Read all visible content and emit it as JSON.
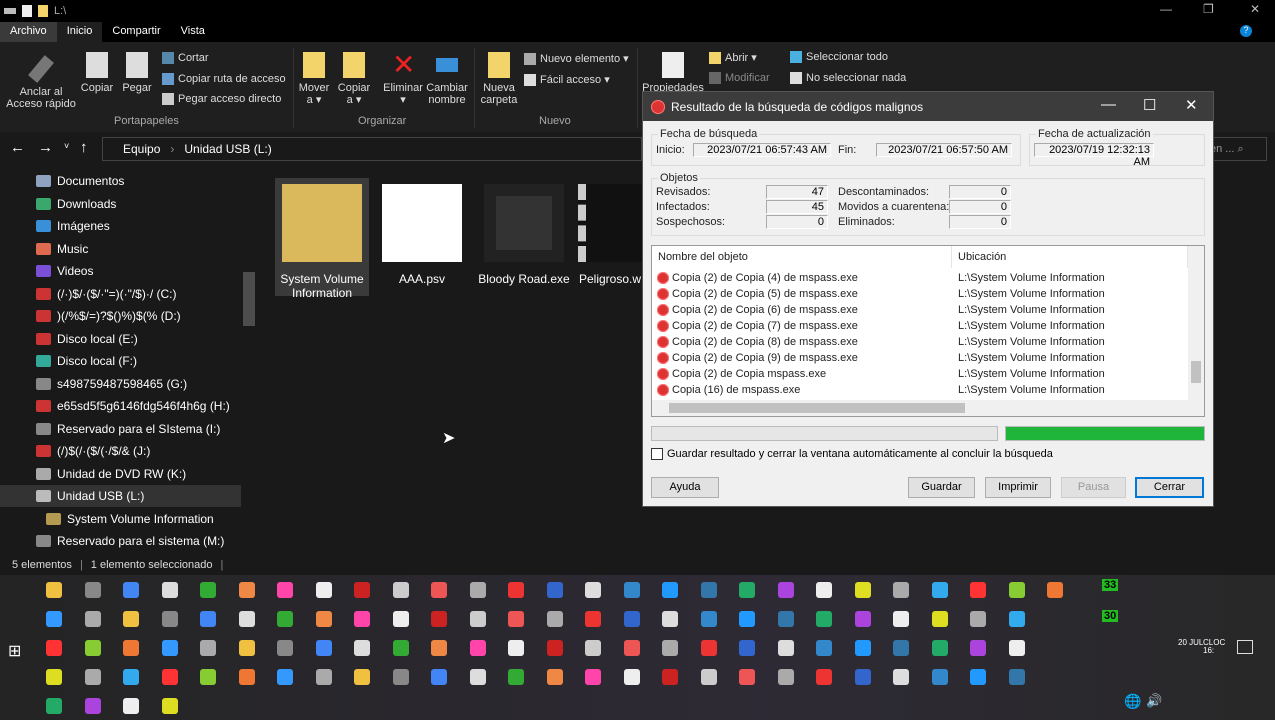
{
  "window": {
    "path": "L:\\",
    "controls": [
      "—",
      "❐",
      "✕"
    ]
  },
  "ribbon": {
    "tabs": [
      "Archivo",
      "Inicio",
      "Compartir",
      "Vista"
    ],
    "pin": "Anclar al Acceso rápido",
    "copy": "Copiar",
    "paste": "Pegar",
    "cut": "Cortar",
    "copy_path": "Copiar ruta de acceso",
    "paste_shortcut": "Pegar acceso directo",
    "group_clipboard": "Portapapeles",
    "move": "Mover a ▾",
    "copy_to": "Copiar a ▾",
    "delete": "Eliminar ▾",
    "rename": "Cambiar nombre",
    "group_organize": "Organizar",
    "new_folder": "Nueva carpeta",
    "new_item": "Nuevo elemento ▾",
    "easy_access": "Fácil acceso ▾",
    "group_new": "Nuevo",
    "properties": "Propiedades",
    "open": "Abrir ▾",
    "edit": "Modificar",
    "select_all": "Seleccionar todo",
    "select_none": "No seleccionar nada"
  },
  "address": {
    "crumbs": [
      "Equipo",
      "Unidad USB (L:)"
    ],
    "search_placeholder": "en ..."
  },
  "sidebar": {
    "items": [
      {
        "label": "Documentos",
        "color": "#8fa3c0"
      },
      {
        "label": "Downloads",
        "color": "#3aa76d"
      },
      {
        "label": "Imágenes",
        "color": "#3a8fd9"
      },
      {
        "label": "Music",
        "color": "#e06a4f"
      },
      {
        "label": "Videos",
        "color": "#7c4fd9"
      },
      {
        "label": "(/·)$/·($/·\"=)(·\"/$)·/ (C:)",
        "color": "#c33"
      },
      {
        "label": ")(/%$/=)?$()%)$(% (D:)",
        "color": "#c33"
      },
      {
        "label": "Disco local (E:)",
        "color": "#c33"
      },
      {
        "label": "Disco local (F:)",
        "color": "#3a9"
      },
      {
        "label": "s498759487598465 (G:)",
        "color": "#888"
      },
      {
        "label": "e65sd5f5g6146fdg546f4h6g (H:)",
        "color": "#c33"
      },
      {
        "label": "Reservado para el SIstema (I:)",
        "color": "#888"
      },
      {
        "label": "(/)$(/·($/(·/$/& (J:)",
        "color": "#c33"
      },
      {
        "label": "Unidad de DVD RW (K:)",
        "color": "#aaa"
      },
      {
        "label": "Unidad USB (L:)",
        "color": "#bbb",
        "selected": true
      },
      {
        "label": "System Volume Information",
        "color": "#b59a52",
        "child": true
      },
      {
        "label": "Reservado para el sistema (M:)",
        "color": "#888"
      }
    ]
  },
  "files": [
    {
      "name": "System Volume Information",
      "selected": true
    },
    {
      "name": "AAA.psv"
    },
    {
      "name": "Bloody Road.exe"
    },
    {
      "name": "Peligroso.w"
    }
  ],
  "status": {
    "count": "5 elementos",
    "selected": "1 elemento seleccionado"
  },
  "dialog": {
    "title": "Resultado de la búsqueda de códigos malignos",
    "search_date": "Fecha de búsqueda",
    "start_label": "Inicio:",
    "start": "2023/07/21 06:57:43 AM",
    "end_label": "Fin:",
    "end": "2023/07/21 06:57:50 AM",
    "update_date": "Fecha de actualización",
    "update": "2023/07/19 12:32:13 AM",
    "objects": "Objetos",
    "stats": [
      {
        "label": "Revisados:",
        "value": "47"
      },
      {
        "label": "Infectados:",
        "value": "45"
      },
      {
        "label": "Sospechosos:",
        "value": "0"
      },
      {
        "label": "Descontaminados:",
        "value": "0"
      },
      {
        "label": "Movidos a cuarentena:",
        "value": "0"
      },
      {
        "label": "Eliminados:",
        "value": "0"
      }
    ],
    "columns": [
      "Nombre del objeto",
      "Ubicación"
    ],
    "rows": [
      [
        "Copia (2) de Copia (4) de mspass.exe",
        "L:\\System Volume Information"
      ],
      [
        "Copia (2) de Copia (5) de mspass.exe",
        "L:\\System Volume Information"
      ],
      [
        "Copia (2) de Copia (6) de mspass.exe",
        "L:\\System Volume Information"
      ],
      [
        "Copia (2) de Copia (7) de mspass.exe",
        "L:\\System Volume Information"
      ],
      [
        "Copia (2) de Copia (8) de mspass.exe",
        "L:\\System Volume Information"
      ],
      [
        "Copia (2) de Copia (9) de mspass.exe",
        "L:\\System Volume Information"
      ],
      [
        "Copia (2) de Copia mspass.exe",
        "L:\\System Volume Information"
      ],
      [
        "Copia (16) de mspass.exe",
        "L:\\System Volume Information"
      ]
    ],
    "progress_percent": 100,
    "progress_color": "#1fb53a",
    "auto_close": "Guardar resultado y cerrar la ventana automáticamente al concluir la búsqueda",
    "auto_close_checked": false,
    "buttons": {
      "help": "Ayuda",
      "save": "Guardar",
      "print": "Imprimir",
      "pause": "Pausa",
      "close": "Cerrar"
    }
  },
  "taskbar": {
    "tray_date": "20 JUL",
    "tray_clock": "CLOC 16:",
    "tray_numbers": [
      "33",
      "30"
    ],
    "icon_colors": [
      "#f0c040",
      "#888",
      "#4285f4",
      "#ddd",
      "#3a3",
      "#e84",
      "#f4a",
      "#eee",
      "#c22",
      "#ccc",
      "#e55",
      "#aaa",
      "#e33",
      "#36c",
      "#ddd",
      "#38c",
      "#29f",
      "#37a",
      "#2a6",
      "#a4d",
      "#eee",
      "#dd2",
      "#aaa",
      "#3ae",
      "#f33",
      "#8c3",
      "#e73",
      "#39f",
      "#aaa"
    ]
  }
}
